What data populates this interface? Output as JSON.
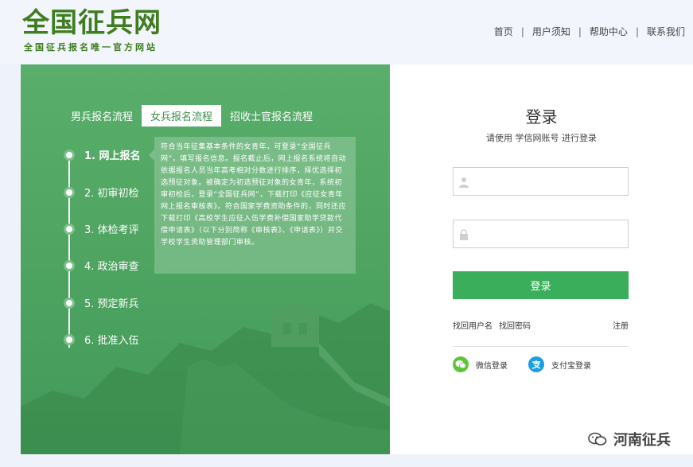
{
  "header": {
    "logo_title": "全国征兵网",
    "logo_subtitle": "全国征兵报名唯一官方网站",
    "nav": [
      "首页",
      "用户须知",
      "帮助中心",
      "联系我们"
    ],
    "nav_sep": "|"
  },
  "left": {
    "tabs": [
      "男兵报名流程",
      "女兵报名流程",
      "招收士官报名流程"
    ],
    "active_tab": 1,
    "steps": [
      "1. 网上报名",
      "2. 初审初检",
      "3. 体检考评",
      "4. 政治审查",
      "5. 预定新兵",
      "6. 批准入伍"
    ],
    "description": "符合当年征集基本条件的女青年，可登录“全国征兵网”，填写报名信息。报名截止后，网上报名系统将自动依据报名人员当年高考相对分数进行排序，择优选择初选预征对象。被确定为初选预征对象的女青年，系统初审初检后，登录“全国征兵网”，下载打印《应征女青年网上报名审核表》。符合国家学费资助条件的，同时还应下载打印《高校学生应征入伍学费补偿国家助学贷款代偿申请表》（以下分别简称《审核表》、《申请表》）并交学校学生资助管理部门审核。"
  },
  "login": {
    "title": "登录",
    "subtitle": "请使用  学信网账号  进行登录",
    "username_placeholder": "",
    "password_placeholder": "",
    "button": "登录",
    "find_username": "找回用户名",
    "find_password": "找回密码",
    "register": "注册",
    "wechat": "微信登录",
    "alipay": "支付宝登录"
  },
  "watermark": {
    "text": "河南征兵"
  },
  "colors": {
    "brand_green": "#3f7d1f",
    "panel_green": "#4fa561",
    "button_green": "#3aae5b",
    "wechat": "#5ec53a",
    "alipay": "#1a9fe6"
  }
}
